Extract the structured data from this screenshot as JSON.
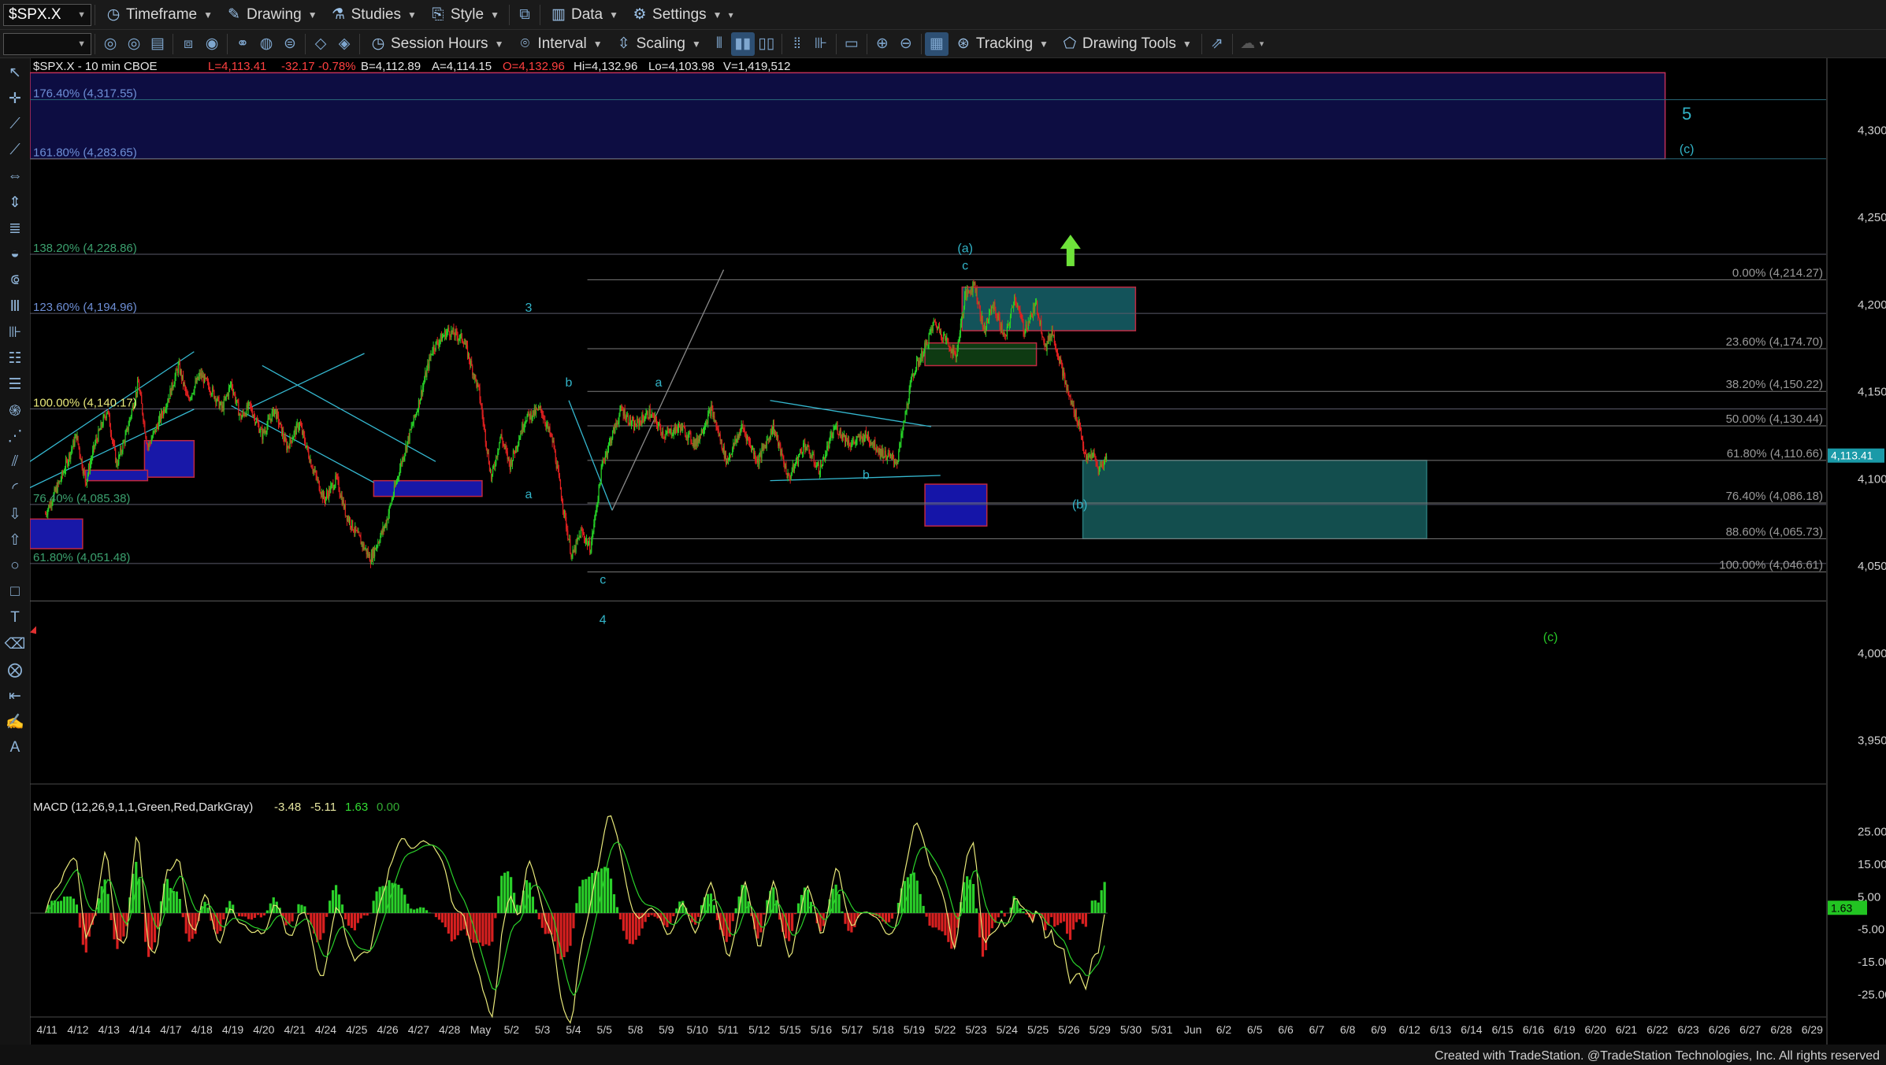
{
  "toolbar": {
    "symbol": "$SPX.X",
    "timeframe": "Timeframe",
    "drawing": "Drawing",
    "studies": "Studies",
    "style": "Style",
    "data": "Data",
    "settings": "Settings",
    "session_hours": "Session Hours",
    "interval": "Interval",
    "scaling": "Scaling",
    "tracking": "Tracking",
    "drawing_tools": "Drawing Tools"
  },
  "footer": "Created with TradeStation. @TradeStation Technologies, Inc. All rights reserved",
  "colors": {
    "up": "#27d127",
    "down": "#e02020",
    "wave_label": "#32b4c8",
    "fib_line": "#8a8a8a",
    "box_blue": "#1a1ab0",
    "box_teal": "#1a6b6b"
  },
  "chart_data": {
    "type": "candlestick",
    "header": {
      "title": "$SPX.X - 10 min  CBOE",
      "last": "L=4,113.41",
      "change": "-32.17",
      "change_pct": "-0.78%",
      "bid": "B=4,112.89",
      "ask": "A=4,114.15",
      "open": "O=4,132.96",
      "high": "Hi=4,132.96",
      "low": "Lo=4,103.98",
      "volume": "V=1,419,512"
    },
    "price_axis": {
      "ylim": [
        3925,
        4335
      ],
      "ticks": [
        "4,300.00",
        "4,250.00",
        "4,200.00",
        "4,150.00",
        "4,100.00",
        "4,050.00",
        "4,000.00",
        "3,950.00"
      ],
      "tick_values": [
        4300,
        4250,
        4200,
        4150,
        4100,
        4050,
        4000,
        3950
      ],
      "last_price_label": "4,113.41"
    },
    "x_axis": {
      "labels": [
        "4/11",
        "4/12",
        "4/13",
        "4/14",
        "4/17",
        "4/18",
        "4/19",
        "4/20",
        "4/21",
        "4/24",
        "4/25",
        "4/26",
        "4/27",
        "4/28",
        "May",
        "5/2",
        "5/3",
        "5/4",
        "5/5",
        "5/8",
        "5/9",
        "5/10",
        "5/11",
        "5/12",
        "5/15",
        "5/16",
        "5/17",
        "5/18",
        "5/19",
        "5/22",
        "5/23",
        "5/24",
        "5/25",
        "5/26",
        "5/29",
        "5/30",
        "5/31",
        "Jun",
        "6/2",
        "6/5",
        "6/6",
        "6/7",
        "6/8",
        "6/9",
        "6/12",
        "6/13",
        "6/14",
        "6/15",
        "6/16",
        "6/19",
        "6/20",
        "6/21",
        "6/22",
        "6/23",
        "6/26",
        "6/27",
        "6/28",
        "6/29"
      ]
    },
    "price_path": [
      [
        0,
        4080
      ],
      [
        0.5,
        4100
      ],
      [
        1,
        4125
      ],
      [
        1.3,
        4098
      ],
      [
        1.6,
        4120
      ],
      [
        2,
        4140
      ],
      [
        2.3,
        4108
      ],
      [
        2.6,
        4125
      ],
      [
        3,
        4155
      ],
      [
        3.3,
        4118
      ],
      [
        3.6,
        4130
      ],
      [
        4,
        4148
      ],
      [
        4.3,
        4165
      ],
      [
        4.6,
        4145
      ],
      [
        5,
        4160
      ],
      [
        5.4,
        4150
      ],
      [
        5.7,
        4140
      ],
      [
        6,
        4155
      ],
      [
        6.3,
        4135
      ],
      [
        6.6,
        4142
      ],
      [
        7,
        4125
      ],
      [
        7.4,
        4140
      ],
      [
        7.8,
        4118
      ],
      [
        8.2,
        4132
      ],
      [
        8.6,
        4108
      ],
      [
        9,
        4088
      ],
      [
        9.4,
        4100
      ],
      [
        9.7,
        4080
      ],
      [
        10,
        4070
      ],
      [
        10.5,
        4054
      ],
      [
        11,
        4075
      ],
      [
        11.5,
        4110
      ],
      [
        12,
        4140
      ],
      [
        12.5,
        4175
      ],
      [
        13,
        4185
      ],
      [
        13.5,
        4180
      ],
      [
        14,
        4150
      ],
      [
        14.4,
        4100
      ],
      [
        14.7,
        4125
      ],
      [
        15,
        4108
      ],
      [
        15.5,
        4135
      ],
      [
        16,
        4140
      ],
      [
        16.4,
        4120
      ],
      [
        16.8,
        4075
      ],
      [
        17,
        4055
      ],
      [
        17.3,
        4070
      ],
      [
        17.6,
        4060
      ],
      [
        18,
        4110
      ],
      [
        18.3,
        4125
      ],
      [
        18.6,
        4140
      ],
      [
        19,
        4130
      ],
      [
        19.5,
        4138
      ],
      [
        20,
        4125
      ],
      [
        20.5,
        4130
      ],
      [
        21,
        4120
      ],
      [
        21.5,
        4140
      ],
      [
        22,
        4110
      ],
      [
        22.5,
        4130
      ],
      [
        23,
        4110
      ],
      [
        23.5,
        4130
      ],
      [
        24,
        4100
      ],
      [
        24.5,
        4120
      ],
      [
        25,
        4105
      ],
      [
        25.5,
        4130
      ],
      [
        26,
        4120
      ],
      [
        26.5,
        4125
      ],
      [
        27,
        4115
      ],
      [
        27.5,
        4110
      ],
      [
        27.8,
        4140
      ],
      [
        28,
        4160
      ],
      [
        28.4,
        4175
      ],
      [
        28.7,
        4190
      ],
      [
        29,
        4182
      ],
      [
        29.4,
        4170
      ],
      [
        29.7,
        4205
      ],
      [
        30,
        4212
      ],
      [
        30.3,
        4185
      ],
      [
        30.6,
        4200
      ],
      [
        31,
        4180
      ],
      [
        31.3,
        4205
      ],
      [
        31.6,
        4185
      ],
      [
        32,
        4200
      ],
      [
        32.3,
        4175
      ],
      [
        32.5,
        4185
      ],
      [
        32.8,
        4165
      ],
      [
        33,
        4150
      ],
      [
        33.2,
        4140
      ],
      [
        33.4,
        4130
      ],
      [
        33.6,
        4110
      ],
      [
        33.8,
        4115
      ],
      [
        34,
        4105
      ],
      [
        34.3,
        4113
      ]
    ],
    "macd": {
      "label": "MACD (12,26,9,1,1,Green,Red,DarkGray)",
      "macd": "-3.48",
      "signal": "-5.11",
      "diff": "1.63",
      "zero": "0.00",
      "ticks": [
        "25.00",
        "15.00",
        "5.00",
        "-5.00",
        "-15.00",
        "-25.00"
      ],
      "tick_values": [
        25,
        15,
        5,
        -5,
        -15,
        -25
      ],
      "ylim": [
        -30,
        30
      ],
      "last_label": "1.63"
    },
    "fib_levels_left": [
      {
        "label": "176.40% (4,317.55)",
        "value": 4317.55
      },
      {
        "label": "161.80% (4,283.65)",
        "value": 4283.65
      },
      {
        "label": "138.20% (4,228.86)",
        "value": 4228.86
      },
      {
        "label": "123.60% (4,194.96)",
        "value": 4194.96
      },
      {
        "label": "100.00% (4,140.17)",
        "value": 4140.17
      },
      {
        "label": "76.40% (4,085.38)",
        "value": 4085.38
      },
      {
        "label": "61.80% (4,051.48)",
        "value": 4051.48
      }
    ],
    "fib_levels_right": [
      {
        "label": "0.00% (4,214.27)",
        "value": 4214.27
      },
      {
        "label": "23.60% (4,174.70)",
        "value": 4174.7
      },
      {
        "label": "38.20% (4,150.22)",
        "value": 4150.22
      },
      {
        "label": "50.00% (4,130.44)",
        "value": 4130.44
      },
      {
        "label": "61.80% (4,110.66)",
        "value": 4110.66
      },
      {
        "label": "76.40% (4,086.18)",
        "value": 4086.18
      },
      {
        "label": "88.60% (4,065.73)",
        "value": 4065.73
      },
      {
        "label": "100.00% (4,046.61)",
        "value": 4046.61
      }
    ],
    "wave_labels": [
      {
        "text": "3",
        "day": 15.6,
        "price": 4196
      },
      {
        "text": "b",
        "day": 16.9,
        "price": 4153
      },
      {
        "text": "a",
        "day": 19.8,
        "price": 4153
      },
      {
        "text": "a",
        "day": 15.6,
        "price": 4089
      },
      {
        "text": "c",
        "day": 18.0,
        "price": 4040
      },
      {
        "text": "4",
        "day": 18.0,
        "price": 4017
      },
      {
        "text": "b",
        "day": 26.5,
        "price": 4100
      },
      {
        "text": "(a)",
        "day": 29.7,
        "price": 4230
      },
      {
        "text": "c",
        "day": 29.7,
        "price": 4220
      },
      {
        "text": "(b)",
        "day": 33.4,
        "price": 4083
      },
      {
        "text": "5",
        "day": 53.0,
        "price": 4306
      },
      {
        "text": "(c)",
        "day": 53.0,
        "price": 4287
      },
      {
        "text": "(c)",
        "day": 48.6,
        "price": 4007
      }
    ]
  }
}
